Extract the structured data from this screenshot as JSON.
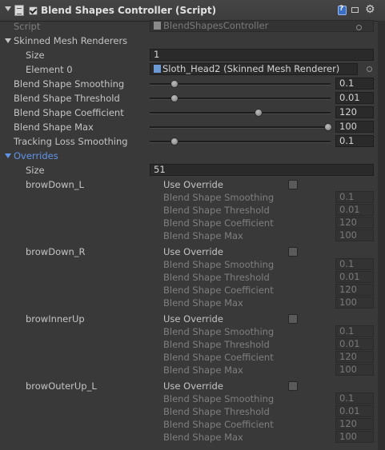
{
  "header": {
    "title": "Blend Shapes Controller (Script)"
  },
  "script": {
    "label": "Script",
    "value": "BlendShapesController"
  },
  "renderers": {
    "label": "Skinned Mesh Renderers",
    "size_label": "Size",
    "size_value": "1",
    "element_label": "Element 0",
    "element_value": "Sloth_Head2 (Skinned Mesh Renderer)"
  },
  "settings": [
    {
      "label": "Blend Shape Smoothing",
      "value": "0.1",
      "level": 0.12
    },
    {
      "label": "Blend Shape Threshold",
      "value": "0.01",
      "level": 0.12
    },
    {
      "label": "Blend Shape Coefficient",
      "value": "120",
      "level": 0.6
    },
    {
      "label": "Blend Shape Max",
      "value": "100",
      "level": 1.0
    },
    {
      "label": "Tracking Loss Smoothing",
      "value": "0.1",
      "level": 0.12
    }
  ],
  "overrides": {
    "label": "Overrides",
    "size_label": "Size",
    "size_value": "51",
    "use_override_label": "Use Override",
    "field_labels": [
      "Blend Shape Smoothing",
      "Blend Shape Threshold",
      "Blend Shape Coefficient",
      "Blend Shape Max"
    ],
    "items": [
      {
        "name": "browDown_L",
        "values": [
          "0.1",
          "0.01",
          "120",
          "100"
        ]
      },
      {
        "name": "browDown_R",
        "values": [
          "0.1",
          "0.01",
          "120",
          "100"
        ]
      },
      {
        "name": "browInnerUp",
        "values": [
          "0.1",
          "0.01",
          "120",
          "100"
        ]
      },
      {
        "name": "browOuterUp_L",
        "values": [
          "0.1",
          "0.01",
          "120",
          "100"
        ]
      }
    ]
  }
}
